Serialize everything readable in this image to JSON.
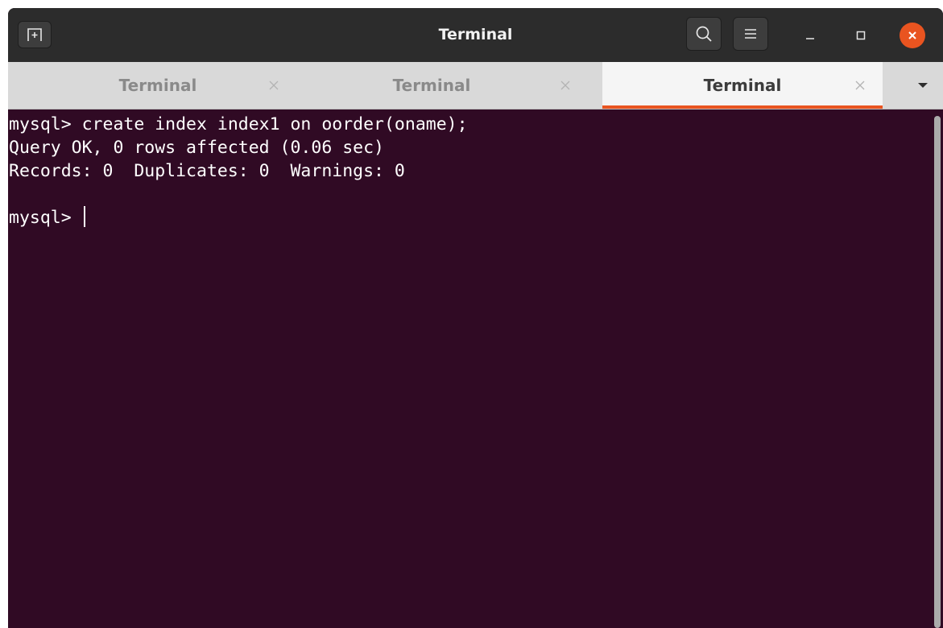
{
  "window": {
    "title": "Terminal"
  },
  "header": {
    "new_tab_icon": "new-tab-icon",
    "search_icon": "search-icon",
    "menu_icon": "hamburger-menu-icon",
    "minimize_icon": "minimize-icon",
    "maximize_icon": "maximize-icon",
    "close_icon": "close-icon",
    "close_color": "#e95420"
  },
  "tabs": [
    {
      "label": "Terminal",
      "active": false
    },
    {
      "label": "Terminal",
      "active": false
    },
    {
      "label": "Terminal",
      "active": true
    }
  ],
  "tab_accent": "#e95420",
  "terminal": {
    "background": "#300a24",
    "lines": [
      "mysql> create index index1 on oorder(oname);",
      "Query OK, 0 rows affected (0.06 sec)",
      "Records: 0  Duplicates: 0  Warnings: 0",
      "",
      "mysql> "
    ]
  }
}
